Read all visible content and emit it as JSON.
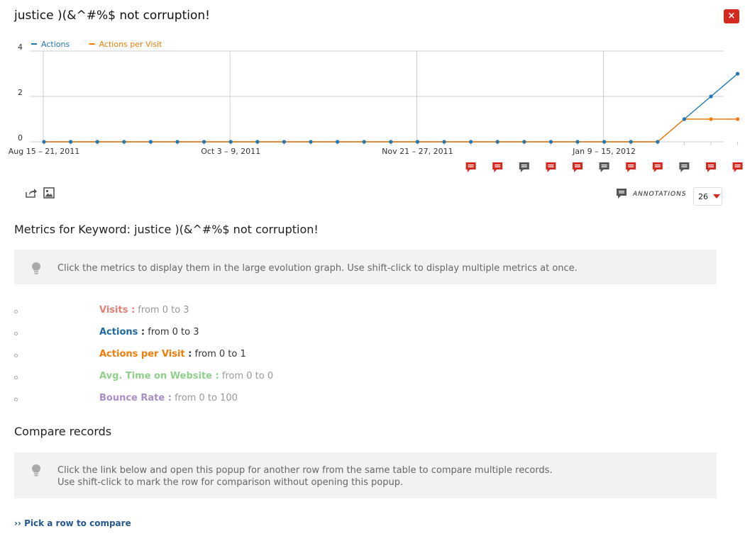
{
  "popup": {
    "title": "justice )(&^#%$ not corruption!",
    "close_symbol": "×"
  },
  "chart_data": {
    "type": "line",
    "x_labels_shown": [
      "Aug 15 – 21, 2011",
      "Oct 3 – 9, 2011",
      "Nov 21 – 27, 2011",
      "Jan 9 – 15, 2012"
    ],
    "ylim": [
      0,
      4
    ],
    "y_ticks": [
      "4",
      "2",
      "0"
    ],
    "grid": true,
    "legend_placement": "top-left",
    "n_points": 27,
    "series": [
      {
        "name": "Actions",
        "color": "#1f78b4",
        "values": [
          0,
          0,
          0,
          0,
          0,
          0,
          0,
          0,
          0,
          0,
          0,
          0,
          0,
          0,
          0,
          0,
          0,
          0,
          0,
          0,
          0,
          0,
          0,
          0,
          1,
          2,
          3
        ]
      },
      {
        "name": "Actions per Visit",
        "color": "#f27c08",
        "values": [
          0,
          0,
          0,
          0,
          0,
          0,
          0,
          0,
          0,
          0,
          0,
          0,
          0,
          0,
          0,
          0,
          0,
          0,
          0,
          0,
          0,
          0,
          0,
          0,
          1,
          1,
          1
        ]
      }
    ],
    "annotation_markers": [
      {
        "period_index": 16,
        "starred": true
      },
      {
        "period_index": 17,
        "starred": true
      },
      {
        "period_index": 18,
        "starred": false
      },
      {
        "period_index": 19,
        "starred": true
      },
      {
        "period_index": 20,
        "starred": true
      },
      {
        "period_index": 21,
        "starred": false
      },
      {
        "period_index": 22,
        "starred": true
      },
      {
        "period_index": 23,
        "starred": true
      },
      {
        "period_index": 24,
        "starred": false
      },
      {
        "period_index": 25,
        "starred": true
      },
      {
        "period_index": 26,
        "starred": true
      }
    ]
  },
  "toolbar": {
    "annotations_label": "ANNOTATIONS",
    "periods_value": "26"
  },
  "metrics_section": {
    "title": "Metrics for Keyword: justice )(&^#%$ not corruption!",
    "help": "Click the metrics to display them in the large evolution graph. Use shift-click to display multiple metrics at once.",
    "items": [
      {
        "name": "Visits",
        "sep": " :",
        "range": " from 0 to 3",
        "color": "#e57f73",
        "range_color": "#999999"
      },
      {
        "name": "Actions",
        "sep": " :",
        "range": " from 0 to 3",
        "color": "#1f6aa5",
        "range_color": "#333333"
      },
      {
        "name": "Actions per Visit",
        "sep": " :",
        "range": " from 0 to 1",
        "color": "#f27c08",
        "range_color": "#333333"
      },
      {
        "name": "Avg. Time on Website",
        "sep": " :",
        "range": " from 0 to 0",
        "color": "#8fcf8c",
        "range_color": "#999999"
      },
      {
        "name": "Bounce Rate",
        "sep": " :",
        "range": " from 0 to 100",
        "color": "#a98ec9",
        "range_color": "#999999"
      }
    ]
  },
  "compare_section": {
    "title": "Compare records",
    "help_line1": "Click the link below and open this popup for another row from the same table to compare multiple records.",
    "help_line2": "Use shift-click to mark the row for comparison without opening this popup.",
    "link": "›› Pick a row to compare"
  },
  "colors": {
    "accent_red": "#d4291f",
    "link_blue": "#255792",
    "annotation_dark": "#555555"
  },
  "icons": [
    "close-icon",
    "export-icon",
    "image-icon",
    "annotations-icon",
    "lightbulb-icon",
    "annotation-marker-icon"
  ]
}
